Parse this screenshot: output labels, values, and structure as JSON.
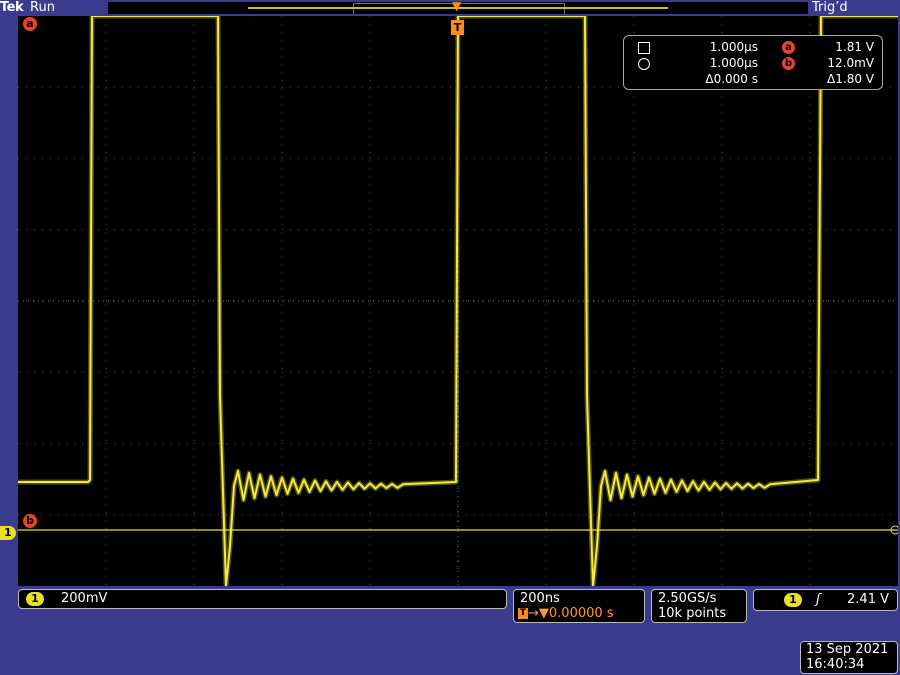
{
  "topbar": {
    "brand": "Tek",
    "status": "Run",
    "trigger_state": "Trig’d"
  },
  "markers": {
    "a": "a",
    "b": "b",
    "ch1": "1",
    "trigger": "T"
  },
  "readout": {
    "row1": {
      "value": "1.000µs",
      "marker": "a",
      "meas": "1.81 V"
    },
    "row2": {
      "value": "1.000µs",
      "marker": "b",
      "meas": "12.0mV"
    },
    "row3": {
      "delta_time": "Δ0.000 s",
      "delta_volt": "Δ1.80 V"
    }
  },
  "channel": {
    "number": "1",
    "scale": "200mV"
  },
  "timebase": {
    "scale": "200ns",
    "position": "0.00000 s"
  },
  "acquisition": {
    "sample_rate": "2.50GS/s",
    "record_length": "10k points"
  },
  "trigger": {
    "channel": "1",
    "slope": "ʃ",
    "level": "2.41 V"
  },
  "datetime": {
    "date": "13 Sep  2021",
    "time": "16:40:34"
  },
  "colors": {
    "trace": "#e8df2a",
    "background": "#3b3b8e",
    "marker": "#e5452d",
    "trigger": "#ff8a1c"
  }
}
